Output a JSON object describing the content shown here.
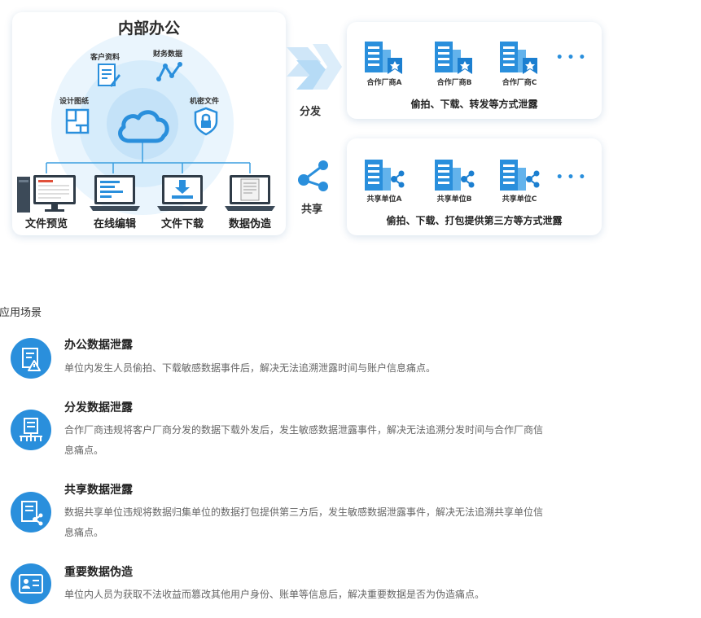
{
  "diagram": {
    "internal": {
      "title": "内部办公",
      "satellites": [
        {
          "label": "客户资料",
          "icon": "customer-document-icon"
        },
        {
          "label": "财务数据",
          "icon": "finance-chart-icon"
        },
        {
          "label": "设计图纸",
          "icon": "blueprint-icon"
        },
        {
          "label": "机密文件",
          "icon": "secure-shield-icon"
        }
      ],
      "center_icon": "cloud-icon",
      "devices": [
        {
          "label": "文件预览",
          "icon": "desktop-computer-icon"
        },
        {
          "label": "在线编辑",
          "icon": "laptop-edit-icon"
        },
        {
          "label": "文件下载",
          "icon": "laptop-download-icon"
        },
        {
          "label": "数据伪造",
          "icon": "laptop-document-icon"
        }
      ]
    },
    "distribute": {
      "label": "分发",
      "partners": [
        "合作厂商A",
        "合作厂商B",
        "合作厂商C"
      ],
      "more": "• • •",
      "caption": "偷拍、下载、转发等方式泄露"
    },
    "share": {
      "label": "共享",
      "partners": [
        "共享单位A",
        "共享单位B",
        "共享单位C"
      ],
      "more": "• • •",
      "caption": "偷拍、下载、打包提供第三方等方式泄露"
    },
    "colors": {
      "accent": "#2a8fdc",
      "light_blue": "#dbeefb",
      "line": "#3a9ee0"
    }
  },
  "scenarios": {
    "heading": "应用场景",
    "items": [
      {
        "title": "办公数据泄露",
        "desc_lines": [
          "单位内发生人员偷拍、下载敏感数据事件后，解决无法追溯泄露时间与账户信息痛点。"
        ],
        "icon": "office-leak-icon"
      },
      {
        "title": "分发数据泄露",
        "desc_lines": [
          "合作厂商违规将客户厂商分发的数据下载外发后，发生敏感数据泄露事件，解决无法追溯分发时间与合作厂商信",
          "息痛点。"
        ],
        "icon": "distribute-leak-icon"
      },
      {
        "title": "共享数据泄露",
        "desc_lines": [
          "数据共享单位违规将数据归集单位的数据打包提供第三方后，发生敏感数据泄露事件，解决无法追溯共享单位信",
          "息痛点。"
        ],
        "icon": "share-leak-icon"
      },
      {
        "title": "重要数据伪造",
        "desc_lines": [
          "单位内人员为获取不法收益而篡改其他用户身份、账单等信息后，解决重要数据是否为伪造痛点。"
        ],
        "icon": "data-forgery-icon"
      }
    ]
  }
}
